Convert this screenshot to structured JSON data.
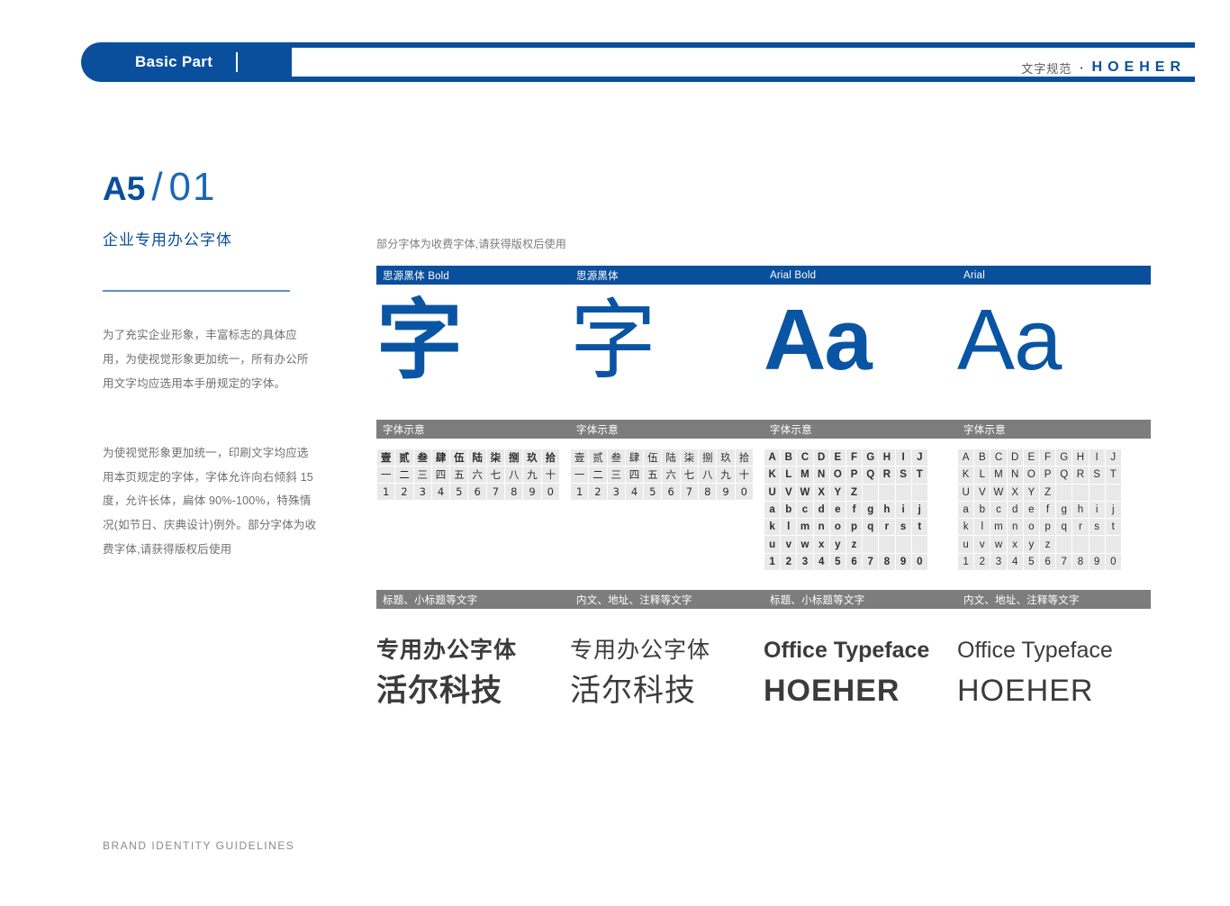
{
  "header": {
    "title": "Basic Part",
    "section_cn": "文字规范",
    "separator_dot": "·",
    "brand": "HOEHER"
  },
  "left": {
    "code_prefix": "A5",
    "code_slash": "/",
    "code_number": "01",
    "subtitle": "企业专用办公字体",
    "paragraph_1": "为了充实企业形象，丰富标志的具体应用，为使视觉形象更加统一，所有办公所用文字均应选用本手册规定的字体。",
    "paragraph_2": "为使视觉形象更加统一，印刷文字均应选用本页规定的字体，字体允许向右倾斜 15 度，允许长体，扁体 90%-100%，特殊情况(如节日、庆典设计)例外。部分字体为收费字体,请获得版权后使用",
    "footer": "BRAND IDENTITY GUIDELINES"
  },
  "panel": {
    "note": "部分字体为收费字体,请获得版权后使用",
    "font_headers": [
      "思源黑体 Bold",
      "思源黑体",
      "Arial Bold",
      "Arial"
    ],
    "specimens": [
      "字",
      "字",
      "Aa",
      "Aa"
    ],
    "glyph_band_labels": [
      "字体示意",
      "字体示意",
      "字体示意",
      "字体示意"
    ],
    "usage_band_labels": [
      "标题、小标题等文字",
      "内文、地址、注释等文字",
      "标题、小标题等文字",
      "内文、地址、注释等文字"
    ],
    "cjk_grid": [
      [
        "壹",
        "贰",
        "叁",
        "肆",
        "伍",
        "陆",
        "柒",
        "捌",
        "玖",
        "拾"
      ],
      [
        "一",
        "二",
        "三",
        "四",
        "五",
        "六",
        "七",
        "八",
        "九",
        "十"
      ],
      [
        "1",
        "2",
        "3",
        "4",
        "5",
        "6",
        "7",
        "8",
        "9",
        "0"
      ]
    ],
    "latin_grid": [
      [
        "A",
        "B",
        "C",
        "D",
        "E",
        "F",
        "G",
        "H",
        "I",
        "J"
      ],
      [
        "K",
        "L",
        "M",
        "N",
        "O",
        "P",
        "Q",
        "R",
        "S",
        "T"
      ],
      [
        "U",
        "V",
        "W",
        "X",
        "Y",
        "Z",
        "",
        "",
        "",
        ""
      ],
      [
        "a",
        "b",
        "c",
        "d",
        "e",
        "f",
        "g",
        "h",
        "i",
        "j"
      ],
      [
        "k",
        "l",
        "m",
        "n",
        "o",
        "p",
        "q",
        "r",
        "s",
        "t"
      ],
      [
        "u",
        "v",
        "w",
        "x",
        "y",
        "z",
        "",
        "",
        "",
        ""
      ],
      [
        "1",
        "2",
        "3",
        "4",
        "5",
        "6",
        "7",
        "8",
        "9",
        "0"
      ]
    ],
    "samples": [
      {
        "line1": "专用办公字体",
        "line2": "活尔科技"
      },
      {
        "line1": "专用办公字体",
        "line2": "活尔科技"
      },
      {
        "line1": "Office Typeface",
        "line2": "HOEHER"
      },
      {
        "line1": "Office Typeface",
        "line2": "HOEHER"
      }
    ]
  },
  "colors": {
    "brand_blue": "#0a4f9c",
    "specimen_blue": "#0a55a3",
    "band_gray": "#7d7d7d",
    "body_text": "#6f6f6f"
  }
}
